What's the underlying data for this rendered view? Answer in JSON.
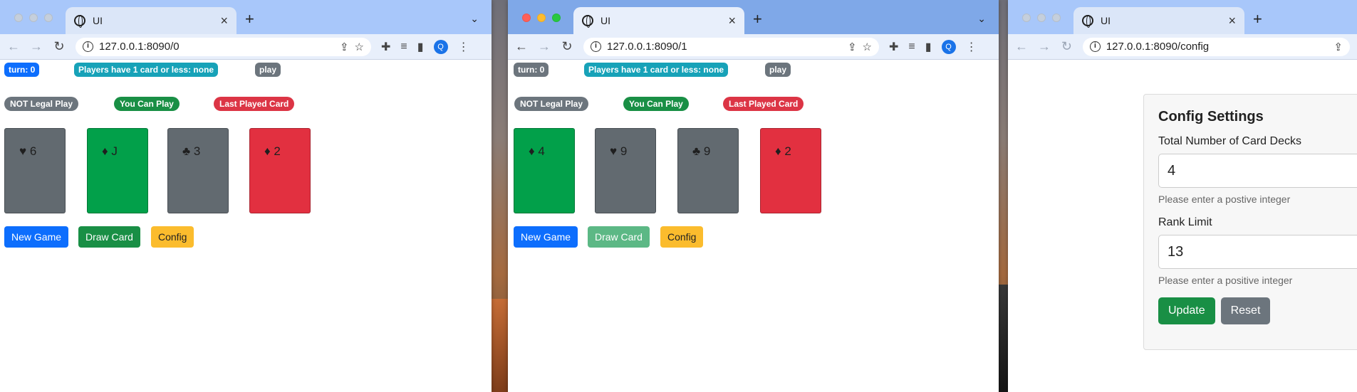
{
  "windows": [
    {
      "tab_title": "UI",
      "url": "127.0.0.1:8090/0",
      "profile_initial": "Q",
      "status": {
        "turn": "turn: 0",
        "players": "Players have 1 card or less: none",
        "play": "play"
      },
      "legend": {
        "not_legal": "NOT Legal Play",
        "can_play": "You Can Play",
        "last_played": "Last Played Card"
      },
      "cards": [
        {
          "suit": "♥",
          "rank": "6",
          "color": "gray"
        },
        {
          "suit": "♦",
          "rank": "J",
          "color": "green"
        },
        {
          "suit": "♣",
          "rank": "3",
          "color": "gray"
        },
        {
          "suit": "♦",
          "rank": "2",
          "color": "red"
        }
      ],
      "buttons": {
        "new_game": "New Game",
        "draw_card": "Draw Card",
        "config": "Config"
      }
    },
    {
      "tab_title": "UI",
      "url": "127.0.0.1:8090/1",
      "profile_initial": "Q",
      "status": {
        "turn": "turn: 0",
        "players": "Players have 1 card or less: none",
        "play": "play"
      },
      "legend": {
        "not_legal": "NOT Legal Play",
        "can_play": "You Can Play",
        "last_played": "Last Played Card"
      },
      "cards": [
        {
          "suit": "♦",
          "rank": "4",
          "color": "green"
        },
        {
          "suit": "♥",
          "rank": "9",
          "color": "gray"
        },
        {
          "suit": "♣",
          "rank": "9",
          "color": "gray"
        },
        {
          "suit": "♦",
          "rank": "2",
          "color": "red"
        }
      ],
      "buttons": {
        "new_game": "New Game",
        "draw_card": "Draw Card",
        "config": "Config"
      }
    },
    {
      "tab_title": "UI",
      "url": "127.0.0.1:8090/config",
      "config": {
        "title": "Config Settings",
        "decks_label": "Total Number of Card Decks",
        "decks_value": "4",
        "decks_help": "Please enter a postive integer",
        "rank_label": "Rank Limit",
        "rank_value": "13",
        "rank_help": "Please enter a positive integer",
        "update": "Update",
        "reset": "Reset"
      }
    }
  ],
  "colors": {
    "primary": "#0d6efd",
    "success": "#198f45",
    "danger": "#dc3545",
    "secondary": "#6c757d",
    "warning": "#fbbc2d",
    "info": "#17a2b8"
  }
}
